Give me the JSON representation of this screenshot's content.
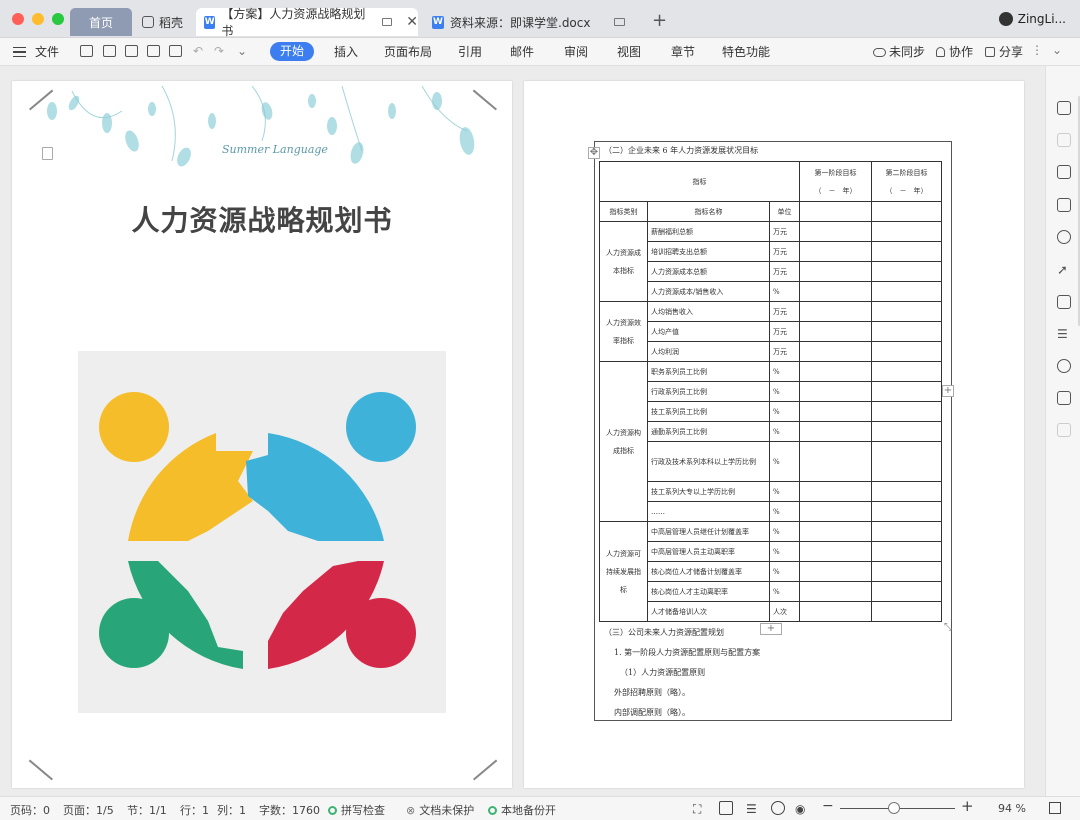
{
  "tabs": {
    "home": "首页",
    "daoke": "稻壳",
    "doc1": "【方案】人力资源战略规划书",
    "doc2": "资料来源：即课学堂.docx",
    "user": "ZingLi..."
  },
  "ribbon": {
    "file": "文件",
    "tabs": [
      "开始",
      "插入",
      "页面布局",
      "引用",
      "邮件",
      "审阅",
      "视图",
      "章节",
      "特色功能"
    ],
    "sync": "未同步",
    "collab": "协作",
    "share": "分享"
  },
  "cover": {
    "logo_text": "Summer Language",
    "title": "人力资源战略规划书"
  },
  "table": {
    "caption": "（二）企业未来 6 年人力资源发展状况目标",
    "head_indicator": "指标",
    "head_stage1": "第一阶段目标",
    "head_stage1_sub": "（　－　年）",
    "head_stage2": "第二阶段目标",
    "head_stage2_sub": "（　－　年）",
    "col_category": "指标类别",
    "col_name": "指标名称",
    "col_unit": "单位",
    "groups": [
      {
        "category": "人力资源成本指标",
        "rows": [
          {
            "name": "薪酬福利总额",
            "unit": "万元"
          },
          {
            "name": "培训招聘支出总额",
            "unit": "万元"
          },
          {
            "name": "人力资源成本总额",
            "unit": "万元"
          },
          {
            "name": "人力资源成本/销售收入",
            "unit": "%"
          }
        ]
      },
      {
        "category": "人力资源效率指标",
        "rows": [
          {
            "name": "人均销售收入",
            "unit": "万元"
          },
          {
            "name": "人均产值",
            "unit": "万元"
          },
          {
            "name": "人均利润",
            "unit": "万元"
          }
        ]
      },
      {
        "category": "人力资源构成指标",
        "rows": [
          {
            "name": "职务系列员工比例",
            "unit": "%"
          },
          {
            "name": "行政系列员工比例",
            "unit": "%"
          },
          {
            "name": "技工系列员工比例",
            "unit": "%"
          },
          {
            "name": "通勤系列员工比例",
            "unit": "%"
          },
          {
            "name": "行政及技术系列本科以上学历比例",
            "unit": "%"
          },
          {
            "name": "技工系列大专以上学历比例",
            "unit": "%"
          },
          {
            "name": "……",
            "unit": "%"
          }
        ]
      },
      {
        "category": "人力资源可持续发展指标",
        "rows": [
          {
            "name": "中高层管理人员继任计划覆盖率",
            "unit": "%"
          },
          {
            "name": "中高层管理人员主动离职率",
            "unit": "%"
          },
          {
            "name": "核心岗位人才储备计划覆盖率",
            "unit": "%"
          },
          {
            "name": "核心岗位人才主动离职率",
            "unit": "%"
          },
          {
            "name": "人才储备培训人次",
            "unit": "人次"
          }
        ]
      }
    ],
    "after": [
      "（三）公司未来人力资源配置规划",
      "1. 第一阶段人力资源配置原则与配置方案",
      "（1）人力资源配置原则",
      "外部招聘原则（略）。",
      "内部调配原则（略）。"
    ]
  },
  "status": {
    "page_code": "页码：0",
    "pages": "页面：1/5",
    "section": "节：1/1",
    "row": "行：1",
    "col": "列：1",
    "words": "字数：1760",
    "spell": "拼写检查",
    "protect": "文档未保护",
    "backup": "本地备份开",
    "zoom": "94 %"
  }
}
